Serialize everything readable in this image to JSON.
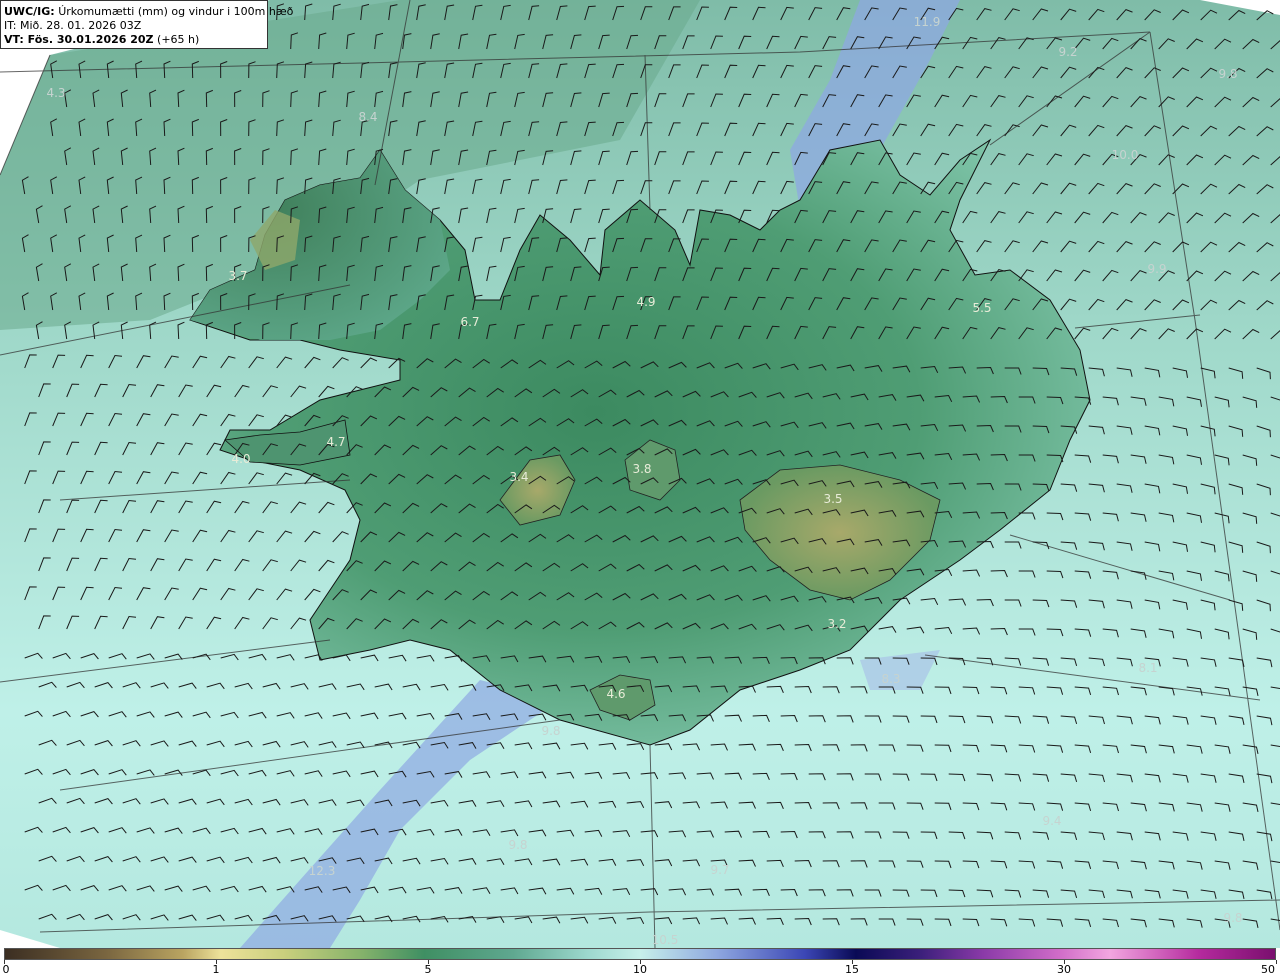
{
  "header": {
    "model_prefix": "UWC/IG:",
    "title": "Úrkomumætti (mm) og vindur i 100m hæð",
    "init_time": "IT: Mið. 28. 01. 2026 03Z",
    "valid_prefix": "VT: Fös. 30.01.2026 20Z",
    "lead_time": "(+65 h)"
  },
  "map": {
    "value_labels": [
      {
        "text": "11.9",
        "zone": "sea"
      },
      {
        "text": "9.2",
        "zone": "sea"
      },
      {
        "text": "9.8",
        "zone": "sea"
      },
      {
        "text": "4.3",
        "zone": "sea"
      },
      {
        "text": "8.4",
        "zone": "sea"
      },
      {
        "text": "10.0",
        "zone": "sea"
      },
      {
        "text": "3.7",
        "zone": "land"
      },
      {
        "text": "9.9",
        "zone": "sea"
      },
      {
        "text": "6.7",
        "zone": "land"
      },
      {
        "text": "4.9",
        "zone": "land"
      },
      {
        "text": "5.5",
        "zone": "land"
      },
      {
        "text": "4.7",
        "zone": "land"
      },
      {
        "text": "4.0",
        "zone": "land"
      },
      {
        "text": "3.4",
        "zone": "land"
      },
      {
        "text": "3.8",
        "zone": "land"
      },
      {
        "text": "3.5",
        "zone": "land"
      },
      {
        "text": "3.2",
        "zone": "land"
      },
      {
        "text": "8.1",
        "zone": "sea"
      },
      {
        "text": "9.8",
        "zone": "sea"
      },
      {
        "text": "4.6",
        "zone": "land"
      },
      {
        "text": "8.3",
        "zone": "sea"
      },
      {
        "text": "9.4",
        "zone": "sea"
      },
      {
        "text": "9.8",
        "zone": "sea"
      },
      {
        "text": "12.3",
        "zone": "sea"
      },
      {
        "text": "9.7",
        "zone": "sea"
      },
      {
        "text": "9.8",
        "zone": "sea"
      },
      {
        "text": "10.5",
        "zone": "sea"
      }
    ]
  },
  "colorbar": {
    "ticks": [
      "0",
      "1",
      "5",
      "10",
      "15",
      "30",
      "50"
    ]
  },
  "colors": {
    "land_low": "#3f8f63",
    "sea": "#b6ece3",
    "high_precip": "#5b6fd6",
    "glacier": "#a9aa69",
    "wind_barb": "#1a1a1a",
    "coastline": "#111111"
  }
}
